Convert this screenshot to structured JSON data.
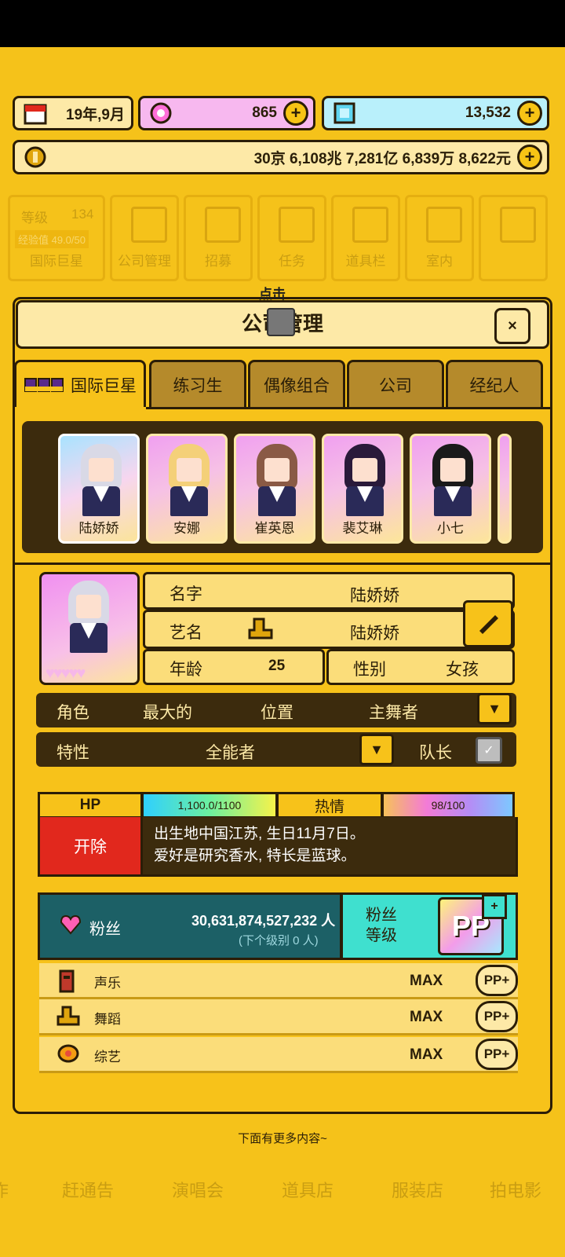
{
  "resources": {
    "date": "19年,9月",
    "gems_pink": "865",
    "diamonds": "13,532",
    "money": "30京 6,108兆 7,281亿 6,839万 8,622元",
    "plus": "+"
  },
  "bg_nav": {
    "level_label": "等级",
    "level_value": "134",
    "exp_label": "经验值 49.0/50",
    "rank": "国际巨星",
    "items": [
      "公司管理",
      "招募",
      "任务",
      "道具栏",
      "室内"
    ]
  },
  "dialog": {
    "hint": "点击",
    "title": "公司管理",
    "close": "×"
  },
  "tabs": [
    "国际巨星",
    "练习生",
    "偶像组合",
    "公司",
    "经纪人"
  ],
  "roster": [
    {
      "name": "陆娇娇",
      "hair": "#d9d9e6"
    },
    {
      "name": "安娜",
      "hair": "#f4d079"
    },
    {
      "name": "崔英恩",
      "hair": "#8a5a45"
    },
    {
      "name": "裴艾琳",
      "hair": "#2a1a3a"
    },
    {
      "name": "小七",
      "hair": "#1a1a1a"
    }
  ],
  "profile": {
    "name_label": "名字",
    "name_value": "陆娇娇",
    "stage_label": "艺名",
    "stage_value": "陆娇娇",
    "age_label": "年龄",
    "age_value": "25",
    "gender_label": "性别",
    "gender_value": "女孩",
    "hearts": "♥♥♥♥♥",
    "role_label": "角色",
    "role_value": "最大的",
    "position_label": "位置",
    "position_value": "主舞者",
    "trait_label": "特性",
    "trait_value": "全能者",
    "leader_label": "队长"
  },
  "stats": {
    "hp_label": "HP",
    "hp_value": "1,100.0/1100",
    "passion_label": "热情",
    "passion_value": "98/100",
    "fire_label": "开除",
    "description_line1": "出生地中国江苏, 生日11月7日。",
    "description_line2": "爱好是研究香水, 特长是蓝球。"
  },
  "fans": {
    "label": "粉丝",
    "count": "30,631,874,527,232 人",
    "next_level": "(下个级别 0 人)",
    "level_label_line1": "粉丝",
    "level_label_line2": "等级",
    "level_badge": "PP"
  },
  "skills": [
    {
      "label": "声乐",
      "value": "MAX",
      "badge": "PP+"
    },
    {
      "label": "舞蹈",
      "value": "MAX",
      "badge": "PP+"
    },
    {
      "label": "综艺",
      "value": "MAX",
      "badge": "PP+"
    }
  ],
  "bottom": {
    "more_hint": "下面有更多内容~",
    "nav": [
      "作",
      "赶通告",
      "演唱会",
      "道具店",
      "服装店",
      "拍电影"
    ]
  },
  "colors": {
    "background": "#f5c21a",
    "panel_dark": "#3c2b0d",
    "fire_red": "#e1281d",
    "fans_teal": "#1c6066",
    "fans_level_cyan": "#3fe0cf"
  }
}
